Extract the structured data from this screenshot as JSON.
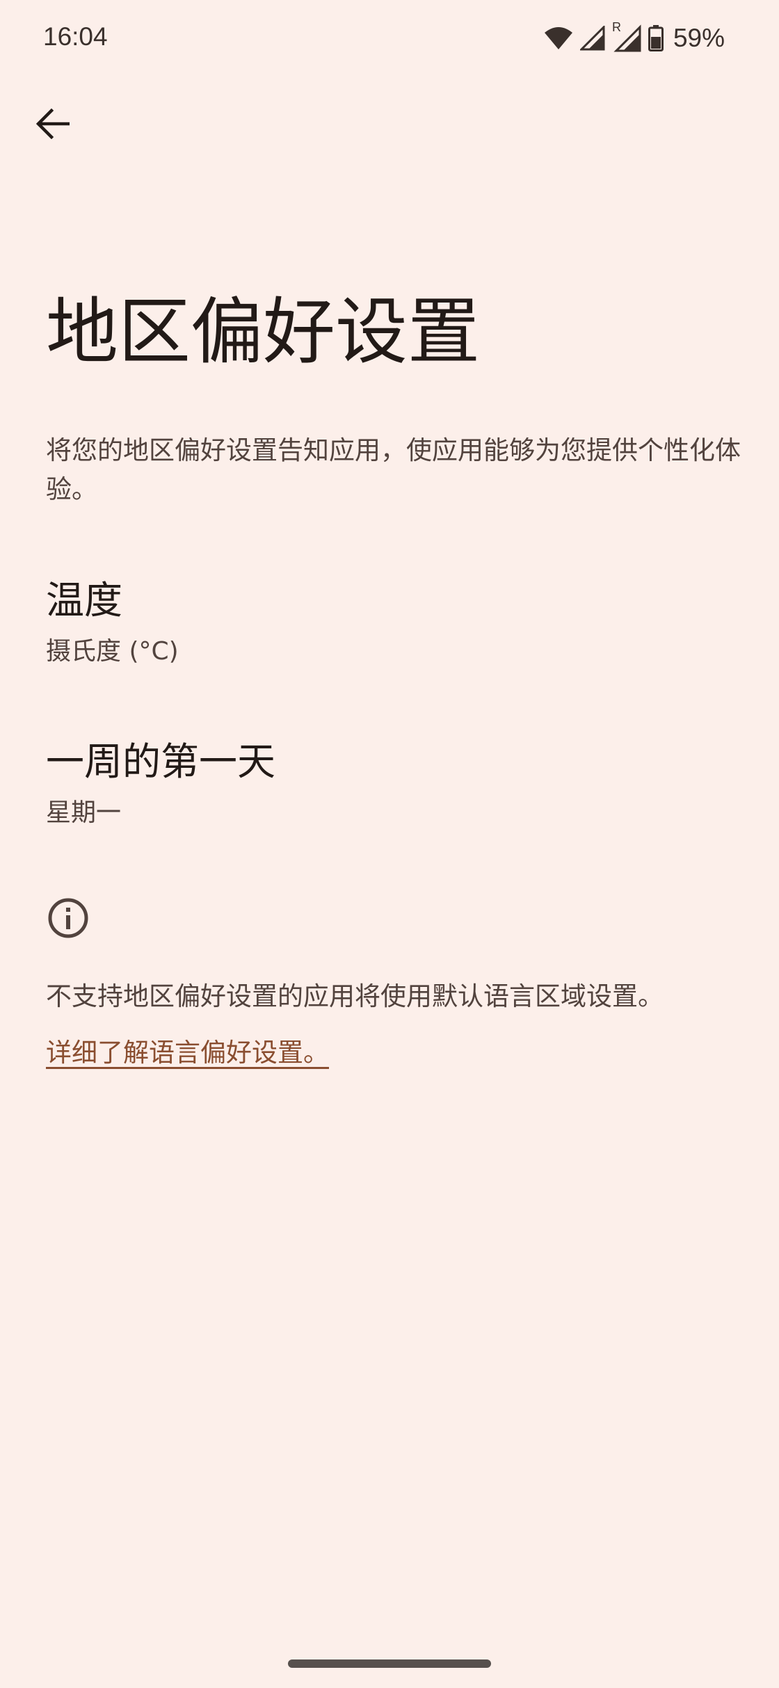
{
  "status_bar": {
    "time": "16:04",
    "battery_percent": "59%",
    "roaming_indicator": "R",
    "icons": [
      "wifi-icon",
      "cell-signal-icon",
      "cell-signal-roaming-icon",
      "battery-icon"
    ]
  },
  "toolbar": {
    "back_icon": "arrow-back-icon"
  },
  "page": {
    "title": "地区偏好设置",
    "description": "将您的地区偏好设置告知应用，使应用能够为您提供个性化体验。"
  },
  "preferences": [
    {
      "title": "温度",
      "summary": "摄氏度 (°C)"
    },
    {
      "title": "一周的第一天",
      "summary": "星期一"
    }
  ],
  "footer": {
    "info_icon": "info-icon",
    "text": "不支持地区偏好设置的应用将使用默认语言区域设置。",
    "link": "详细了解语言偏好设置。"
  },
  "colors": {
    "background": "#fcefea",
    "text_primary": "#221a17",
    "text_secondary": "#52433e",
    "link": "#8a4e30"
  }
}
